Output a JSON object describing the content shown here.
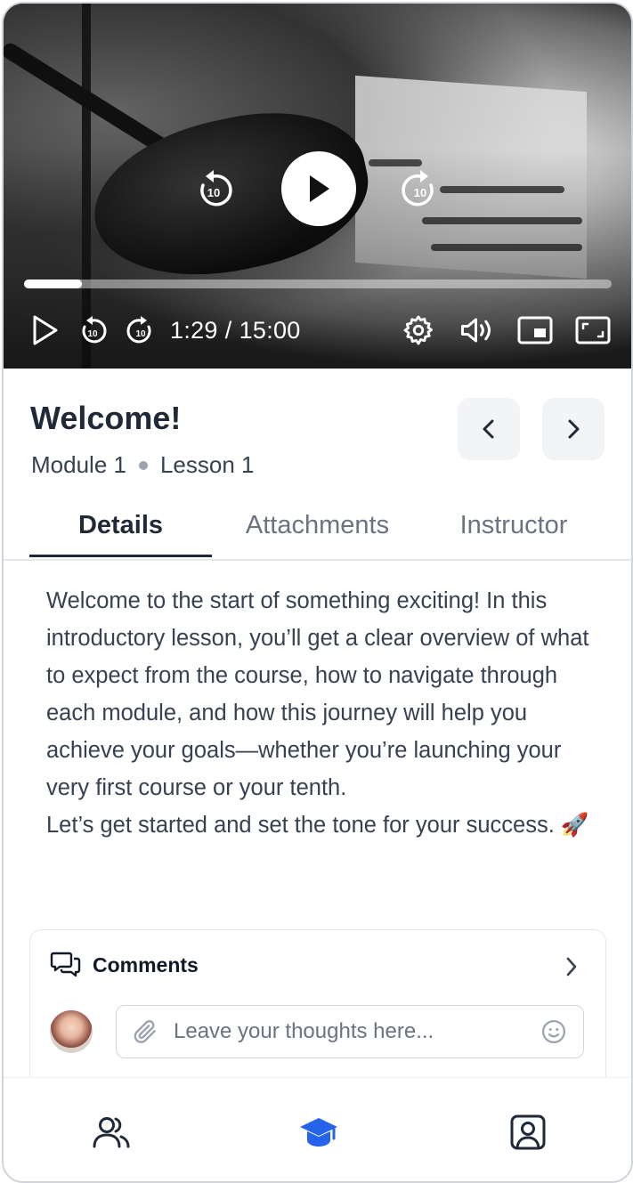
{
  "video": {
    "current_time": "1:29",
    "separator": "/",
    "duration": "15:00",
    "progress_fraction": 0.099,
    "skip_seconds_label": "10"
  },
  "lesson": {
    "title": "Welcome!",
    "module": "Module 1",
    "lesson": "Lesson 1"
  },
  "tabs": [
    {
      "label": "Details",
      "active": true
    },
    {
      "label": "Attachments",
      "active": false
    },
    {
      "label": "Instructor",
      "active": false
    }
  ],
  "description": {
    "paragraph1": "Welcome to the start of something exciting! In this introductory lesson, you’ll get a clear overview of what to expect from the course, how to navigate through each module, and how this journey will help you achieve your goals—whether you’re launching your very first course or your tenth.",
    "paragraph2": "Let’s get started and set the tone for your success. 🚀"
  },
  "comments": {
    "title": "Comments",
    "input_placeholder": "Leave your thoughts here..."
  },
  "bottom_nav": [
    {
      "icon": "community-icon",
      "active": false
    },
    {
      "icon": "courses-icon",
      "active": true
    },
    {
      "icon": "profile-icon",
      "active": false
    }
  ],
  "colors": {
    "accent": "#2563eb",
    "text_primary": "#1f2937",
    "text_secondary": "#6b7280"
  }
}
